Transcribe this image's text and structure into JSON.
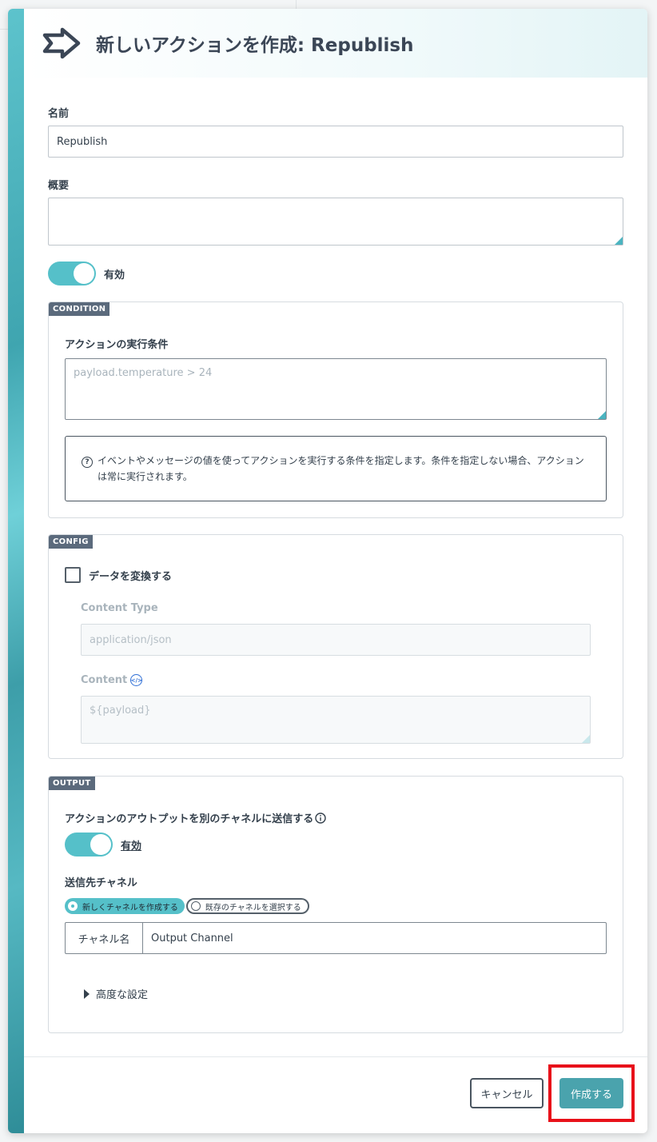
{
  "modal": {
    "title": "新しいアクションを作成: Republish"
  },
  "form": {
    "name_label": "名前",
    "name_value": "Republish",
    "summary_label": "概要",
    "summary_value": "",
    "enabled_label": "有効",
    "enabled": true
  },
  "condition": {
    "tag": "CONDITION",
    "label": "アクションの実行条件",
    "placeholder": "payload.temperature > 24",
    "help_icon": "question-circle-icon",
    "help_text": "イベントやメッセージの値を使ってアクションを実行する条件を指定します。条件を指定しない場合、アクションは常に実行されます。"
  },
  "config": {
    "tag": "CONFIG",
    "transform_label": "データを変換する",
    "transform_checked": false,
    "content_type_label": "Content Type",
    "content_type_placeholder": "application/json",
    "content_label": "Content",
    "content_icon": "code-icon",
    "content_placeholder": "${payload}"
  },
  "output": {
    "tag": "OUTPUT",
    "send_label": "アクションのアウトプットを別のチャネルに送信する",
    "info_icon": "info-circle-icon",
    "enabled_label": "有効",
    "enabled": true,
    "channel_label": "送信先チャネル",
    "radio_new": "新しくチャネルを作成する",
    "radio_existing": "既存のチャネルを選択する",
    "selected_radio": "new",
    "channel_name_label": "チャネル名",
    "channel_name_value": "Output Channel",
    "advanced_label": "高度な設定"
  },
  "footer": {
    "cancel_label": "キャンセル",
    "create_label": "作成する"
  },
  "colors": {
    "accent": "#55c0c9",
    "primary_button": "#4aa3ad",
    "tag_bg": "#5b6a7c",
    "highlight": "#e8111a"
  }
}
